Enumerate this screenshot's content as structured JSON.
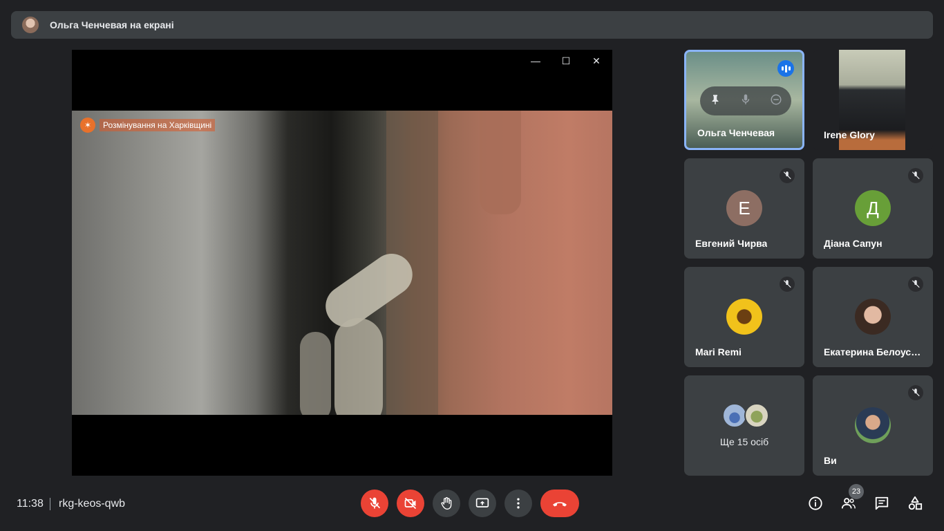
{
  "header": {
    "presenting_label": "Ольга Ченчевая на екрані"
  },
  "presentation": {
    "overlay_caption": "Розмінування на Харківщині"
  },
  "participants": [
    {
      "name": "Ольга Ченчевая",
      "speaking": true
    },
    {
      "name": "Irene Glory"
    },
    {
      "name": "Евгений Чирва",
      "initial": "Е",
      "avatar_color": "#8d6e63"
    },
    {
      "name": "Діана Сапун",
      "initial": "Д",
      "avatar_color": "#689f38"
    },
    {
      "name": "Mari Remi"
    },
    {
      "name": "Екатерина Белоусова"
    },
    {
      "name": "Ви"
    }
  ],
  "overflow": {
    "label": "Ще 15 осіб"
  },
  "footer": {
    "time": "11:38",
    "meeting_code": "rkg-keos-qwb",
    "participant_count": "23"
  },
  "colors": {
    "accent": "#8ab4f8",
    "danger": "#ea4335",
    "surface": "#3c4043",
    "background": "#202124"
  }
}
